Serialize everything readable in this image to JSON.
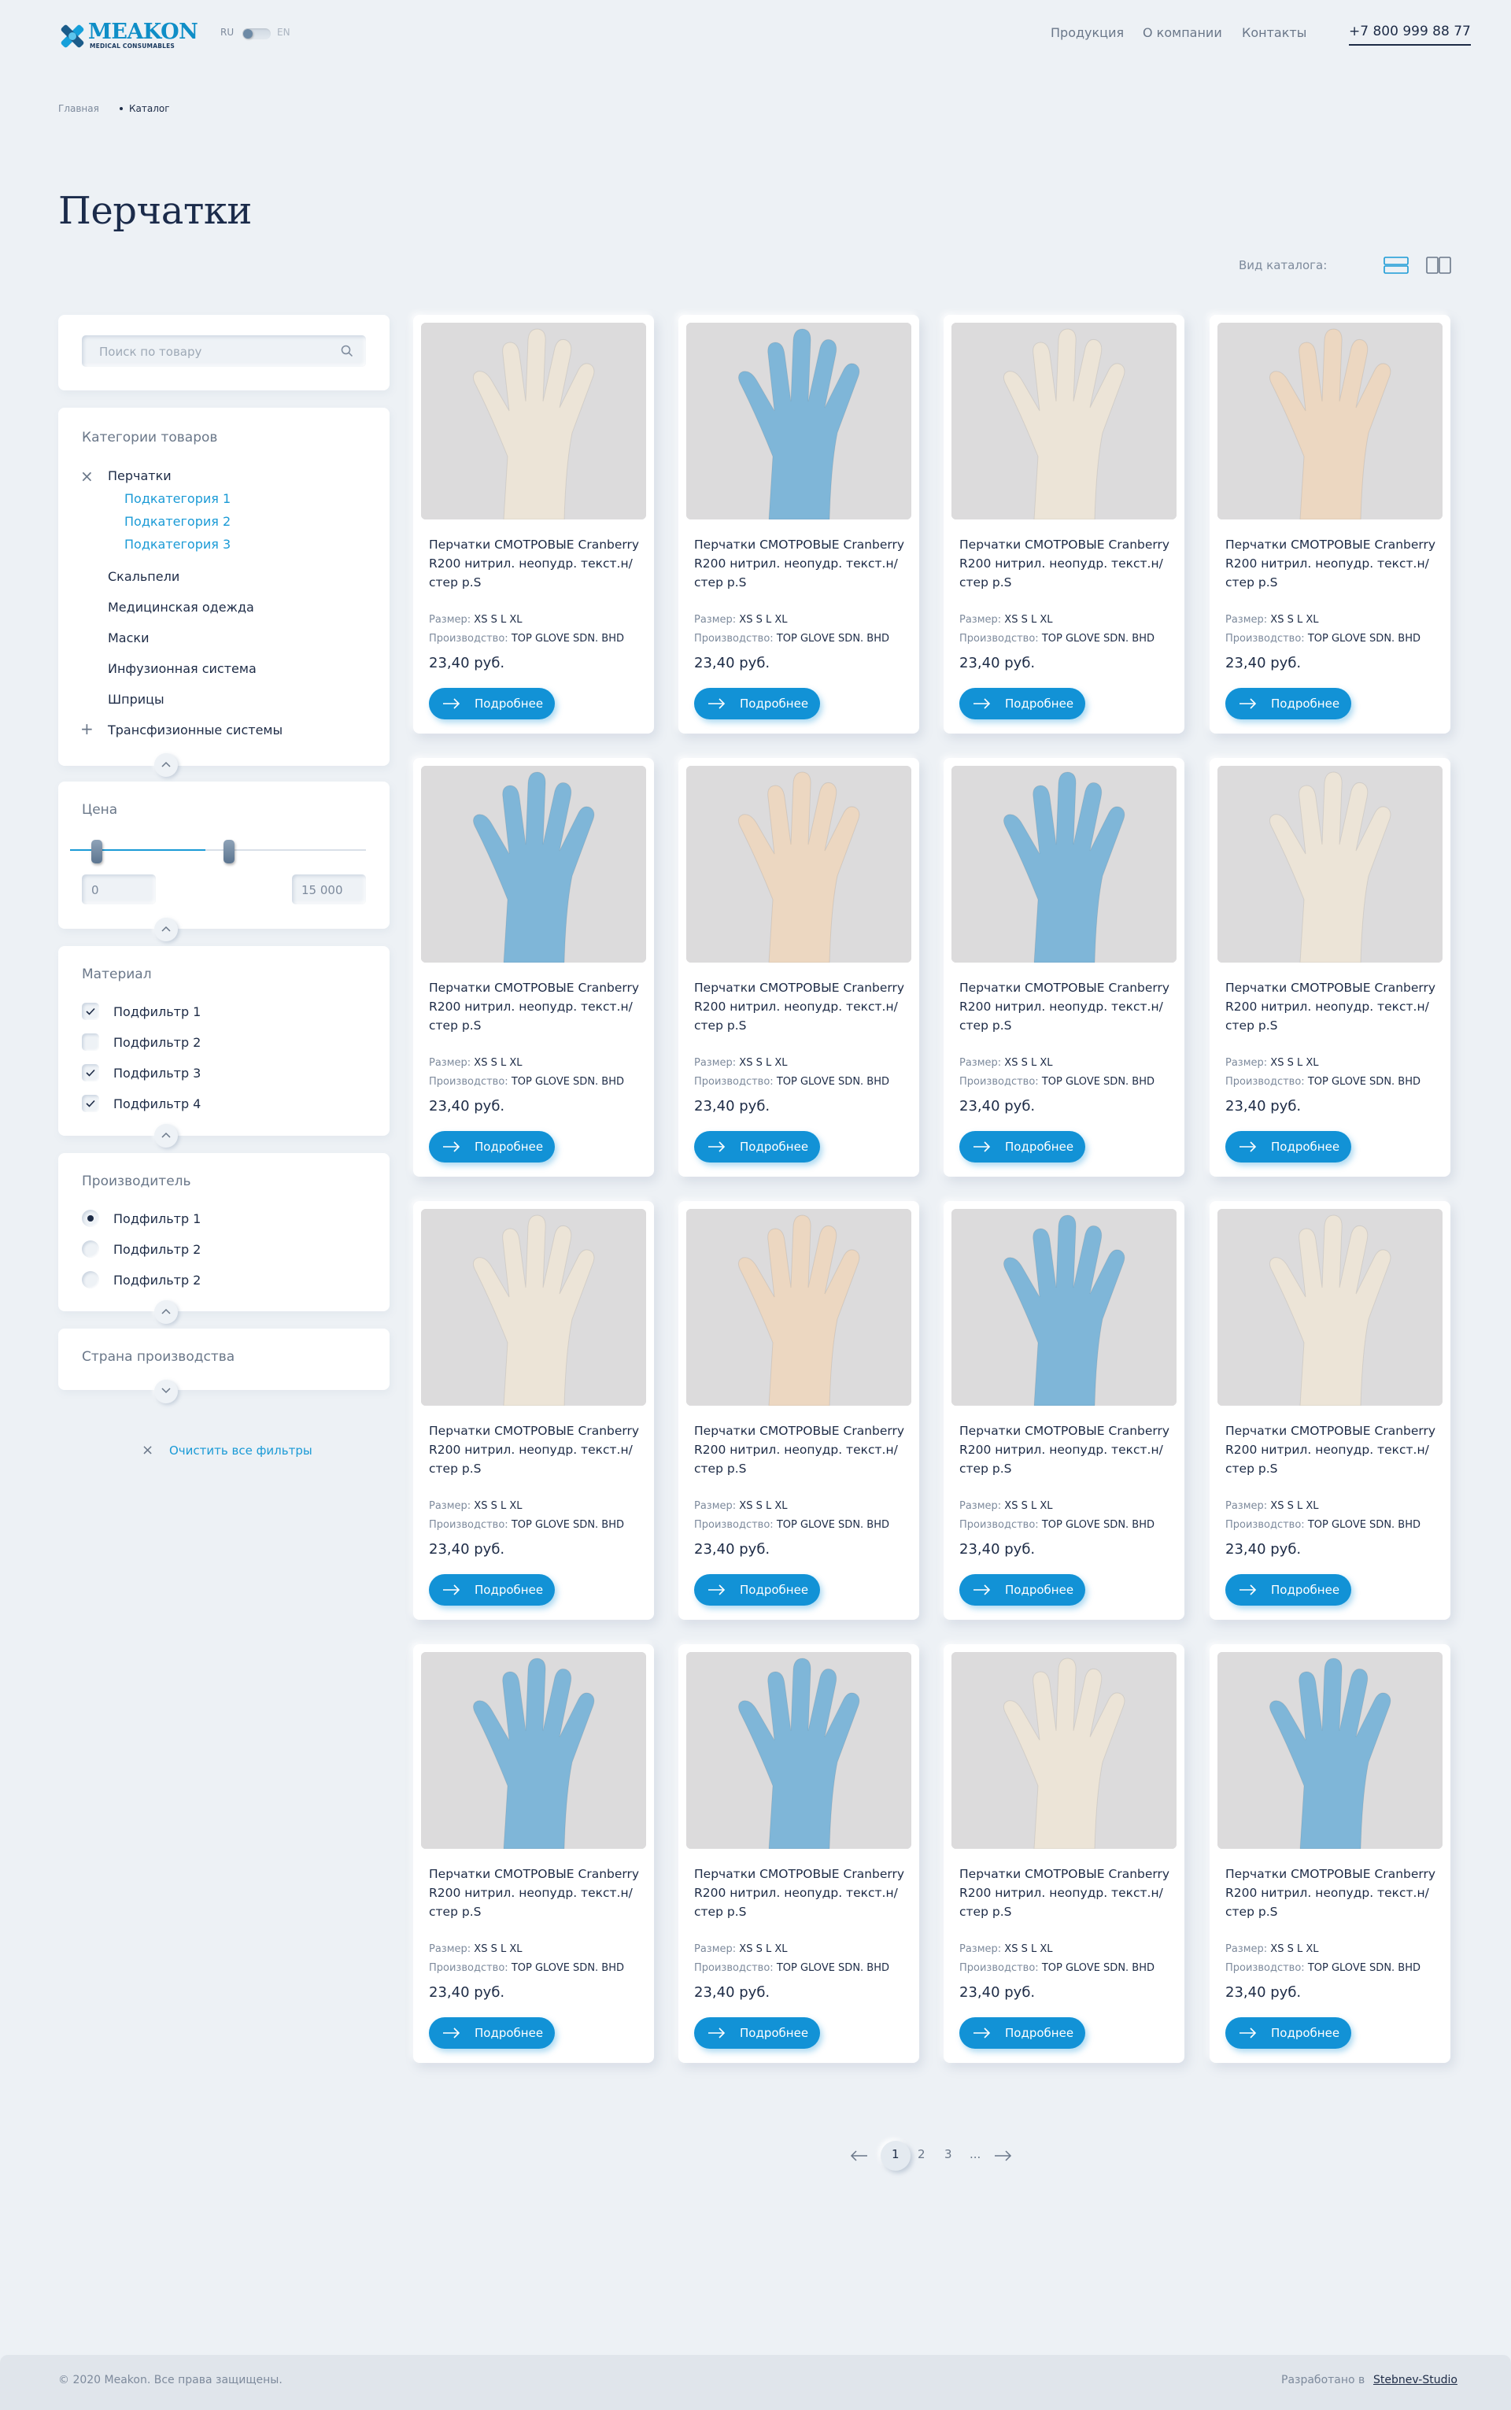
{
  "header": {
    "logo_name": "MEAKON",
    "logo_sub": "MEDICAL CONSUMABLES",
    "lang_ru": "RU",
    "lang_en": "EN",
    "nav": [
      "Продукция",
      "О компании",
      "Контакты"
    ],
    "phone": "+7 800 999 88 77"
  },
  "breadcrumb": {
    "home": "Главная",
    "current": "Каталог"
  },
  "page_title": "Перчатки",
  "view_label": "Вид каталога:",
  "sidebar": {
    "search_placeholder": "Поиск по товару",
    "categories_title": "Категории товаров",
    "categories": [
      {
        "label": "Перчатки",
        "mark": "×",
        "sub": [
          "Подкатегория 1",
          "Подкатегория 2",
          "Подкатегория 3"
        ]
      },
      {
        "label": "Скальпели"
      },
      {
        "label": "Медицинская одежда"
      },
      {
        "label": "Маски"
      },
      {
        "label": "Инфузионная система"
      },
      {
        "label": "Шприцы"
      },
      {
        "label": "Трансфизионные системы",
        "mark": "+"
      }
    ],
    "price_title": "Цена",
    "price_min": "0",
    "price_max": "15 000",
    "material_title": "Материал",
    "material": [
      {
        "label": "Подфильтр 1",
        "checked": true
      },
      {
        "label": "Подфильтр 2",
        "checked": false
      },
      {
        "label": "Подфильтр 3",
        "checked": true
      },
      {
        "label": "Подфильтр 4",
        "checked": true
      }
    ],
    "maker_title": "Производитель",
    "maker": [
      {
        "label": "Подфильтр 1",
        "selected": true
      },
      {
        "label": "Подфильтр 2",
        "selected": false
      },
      {
        "label": "Подфильтр 2",
        "selected": false
      }
    ],
    "country_title": "Страна производства",
    "clear_label": "Очистить все фильтры"
  },
  "product": {
    "name": "Перчатки СМОТРОВЫЕ Cranberry R200 нитрил. неопудр. текст.н/стер р.S",
    "size_label": "Размер:",
    "sizes": "XS  S  L  XL",
    "maker_label": "Производство:",
    "maker": "TOP GLOVE SDN. BHD",
    "price": "23,40 руб.",
    "button": "Подробнее"
  },
  "products": [
    {
      "glove": "white"
    },
    {
      "glove": "blue"
    },
    {
      "glove": "white"
    },
    {
      "glove": "beige"
    },
    {
      "glove": "blue"
    },
    {
      "glove": "beige"
    },
    {
      "glove": "blue"
    },
    {
      "glove": "white"
    },
    {
      "glove": "white"
    },
    {
      "glove": "beige"
    },
    {
      "glove": "blue"
    },
    {
      "glove": "white"
    },
    {
      "glove": "blue"
    },
    {
      "glove": "blue"
    },
    {
      "glove": "white"
    },
    {
      "glove": "blue"
    }
  ],
  "glove_colors": {
    "white": "#ece4d7",
    "blue": "#7fb6d8",
    "beige": "#ecd7c1"
  },
  "pagination": {
    "pages": [
      "1",
      "2",
      "3",
      "..."
    ],
    "active": "1"
  },
  "footer": {
    "copyright": "© 2020 Meakon. Все права защищены.",
    "dev_label": "Разработано в",
    "dev_link": "Stebnev-Studio"
  }
}
